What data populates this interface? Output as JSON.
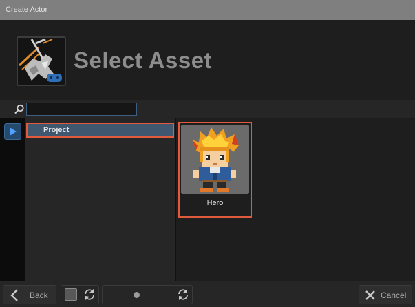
{
  "window": {
    "title": "Create Actor"
  },
  "header": {
    "heading": "Select Asset",
    "logo_icon": "actor-logo-icon"
  },
  "search": {
    "value": "",
    "placeholder": "",
    "icon": "magnifier-icon"
  },
  "sidebar": {
    "play_icon": "play-icon",
    "accent": "#264a6e"
  },
  "tree": {
    "items": [
      {
        "label": "Project",
        "selected": true
      }
    ]
  },
  "assets": [
    {
      "label": "Hero",
      "selected": true,
      "icon": "hero-sprite-icon"
    }
  ],
  "footer": {
    "back_label": "Back",
    "cancel_label": "Cancel",
    "back_icon": "chevron-left-icon",
    "cancel_icon": "close-icon",
    "refresh_icon": "refresh-icon",
    "thumbnail_size": 0.45
  },
  "colors": {
    "selection_outline": "#e05a3e",
    "selection_fill": "#3f5870",
    "focus_outline": "#3e5f82"
  }
}
